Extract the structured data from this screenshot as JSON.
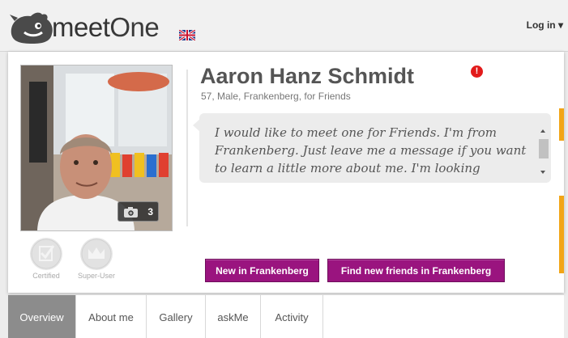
{
  "header": {
    "logo_text_a": "meet",
    "logo_text_b": "One",
    "login_label": "Log in ▾",
    "flag_icon": "uk-flag-icon"
  },
  "profile": {
    "name": "Aaron Hanz Schmidt",
    "meta": "57, Male, Frankenberg, for Friends",
    "photo_count": "3",
    "alert_mark": "!",
    "about": "I would like to meet one for Friends. I'm from Frankenberg. Just leave me a message if you want to learn a little more about me. I'm looking forward to hearing from you."
  },
  "badges": [
    {
      "label": "Certified",
      "icon": "certified-icon"
    },
    {
      "label": "Super-User",
      "icon": "crown-icon"
    }
  ],
  "actions": {
    "new_in_city": "New in Frankenberg",
    "find_friends": "Find new friends in Frankenberg"
  },
  "tabs": [
    {
      "label": "Overview",
      "active": true
    },
    {
      "label": "About me"
    },
    {
      "label": "Gallery"
    },
    {
      "label": "askMe"
    },
    {
      "label": "Activity"
    }
  ],
  "colors": {
    "accent_button": "#9a147f",
    "alert": "#e21b1b",
    "side_accent": "#f2a516"
  }
}
